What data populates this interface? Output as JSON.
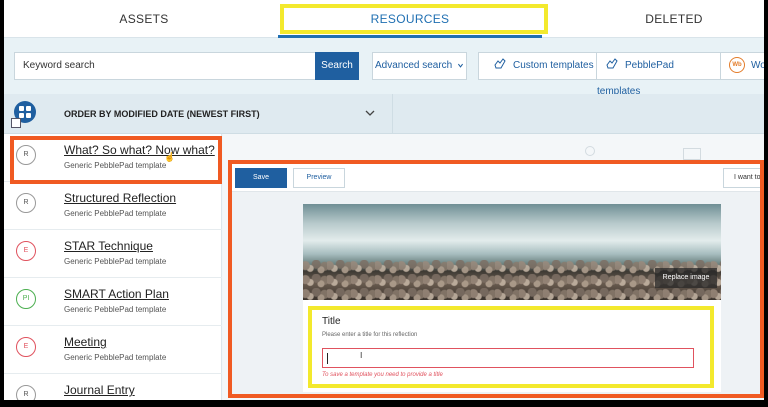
{
  "tabs": {
    "assets": "ASSETS",
    "resources": "RESOURCES",
    "deleted": "DELETED"
  },
  "search": {
    "placeholder": "Keyword search",
    "button": "Search",
    "advanced": "Advanced search",
    "custom_templates": "Custom templates",
    "pebblepad_templates": "PebblePad templates",
    "wb_badge": "Wb",
    "wb_label": "Wo"
  },
  "order": {
    "label": "ORDER BY MODIFIED DATE (NEWEST FIRST)"
  },
  "items": [
    {
      "badge": "R",
      "title": "What? So what? Now what?",
      "subtitle": "Generic PebblePad template"
    },
    {
      "badge": "R",
      "title": "Structured Reflection",
      "subtitle": "Generic PebblePad template"
    },
    {
      "badge": "E",
      "title": "STAR Technique",
      "subtitle": "Generic PebblePad template"
    },
    {
      "badge": "PI",
      "title": "SMART Action Plan",
      "subtitle": "Generic PebblePad template"
    },
    {
      "badge": "E",
      "title": "Meeting",
      "subtitle": "Generic PebblePad template"
    },
    {
      "badge": "R",
      "title": "Journal Entry",
      "subtitle": ""
    }
  ],
  "editor": {
    "save": "Save",
    "preview": "Preview",
    "i_want_to": "I want to",
    "replace_image": "Replace image",
    "title_label": "Title",
    "title_help": "Please enter a title for this reflection",
    "title_error": "To save a template you need to provide a title"
  },
  "colors": {
    "accent": "#1f5fa0",
    "highlight_yellow": "#f3e92d",
    "highlight_orange": "#f05a22",
    "error": "#e0525e"
  }
}
